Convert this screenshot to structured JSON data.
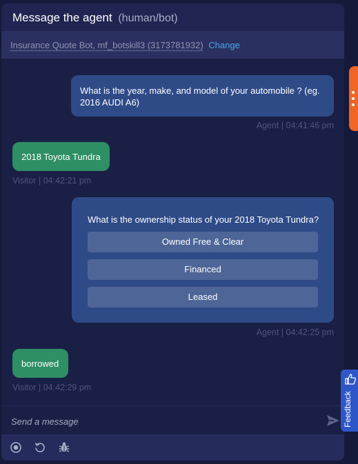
{
  "header": {
    "title": "Message the agent",
    "subtitle": "(human/bot)"
  },
  "bot": {
    "name": "Insurance Quote Bot, mf_botskill3 (3173781932)",
    "change_label": "Change"
  },
  "messages": {
    "m1": {
      "text": "What is the year, make, and model of your automobile ? (eg. 2016 AUDI A6)",
      "meta": "Agent | 04:41:46 pm"
    },
    "m2": {
      "text": "2018 Toyota Tundra",
      "meta": "Visitor | 04:42:21 pm"
    },
    "m3": {
      "question": "What is the ownership status of your 2018 Toyota Tundra?",
      "options": [
        "Owned Free & Clear",
        "Financed",
        "Leased"
      ],
      "meta": "Agent | 04:42:25 pm"
    },
    "m4": {
      "text": "borrowed",
      "meta": "Visitor | 04:42:29 pm"
    }
  },
  "composer": {
    "placeholder": "Send a message"
  },
  "feedback": {
    "label": "Feedback"
  },
  "icons": {
    "send": "send-icon",
    "record": "record-icon",
    "restart": "restart-icon",
    "debug": "bug-icon",
    "menu": "more-vertical-icon",
    "feedback": "thumbs-up-icon"
  },
  "colors": {
    "agent_bubble": "#2e4b88",
    "visitor_bubble": "#2d8f63",
    "accent": "#f06524",
    "link": "#4aa8e8"
  }
}
